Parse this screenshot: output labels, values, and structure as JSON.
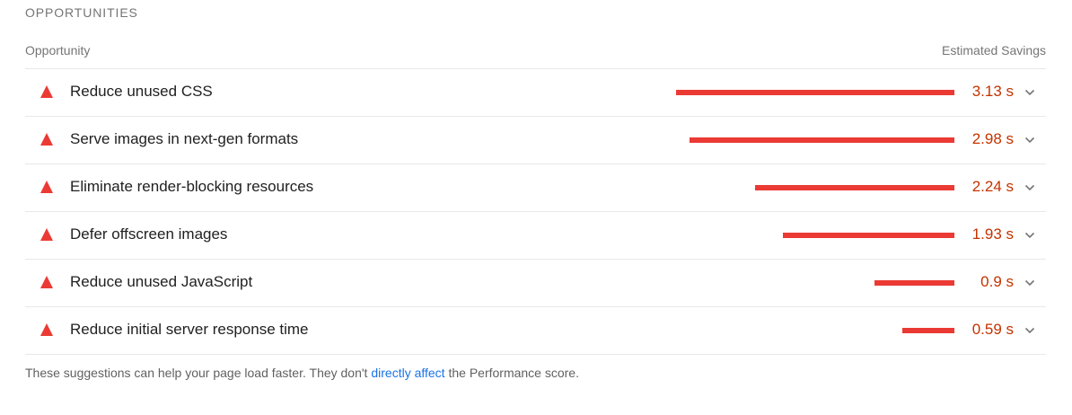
{
  "section": {
    "title": "OPPORTUNITIES"
  },
  "table": {
    "col_left": "Opportunity",
    "col_right": "Estimated Savings",
    "max_savings": 3.13,
    "rows": [
      {
        "label": "Reduce unused CSS",
        "value": "3.13 s",
        "savings": 3.13
      },
      {
        "label": "Serve images in next-gen formats",
        "value": "2.98 s",
        "savings": 2.98
      },
      {
        "label": "Eliminate render-blocking resources",
        "value": "2.24 s",
        "savings": 2.24
      },
      {
        "label": "Defer offscreen images",
        "value": "1.93 s",
        "savings": 1.93
      },
      {
        "label": "Reduce unused JavaScript",
        "value": "0.9 s",
        "savings": 0.9
      },
      {
        "label": "Reduce initial server response time",
        "value": "0.59 s",
        "savings": 0.59
      }
    ]
  },
  "footer": {
    "text_before": "These suggestions can help your page load faster. They don't ",
    "link": "directly affect",
    "text_after": " the Performance score."
  },
  "icons": {
    "row_status": "fail-triangle-icon",
    "expand": "chevron-down-icon"
  },
  "colors": {
    "fail": "#eb3a34",
    "value_text": "#c33300",
    "link": "#1a73e8"
  }
}
